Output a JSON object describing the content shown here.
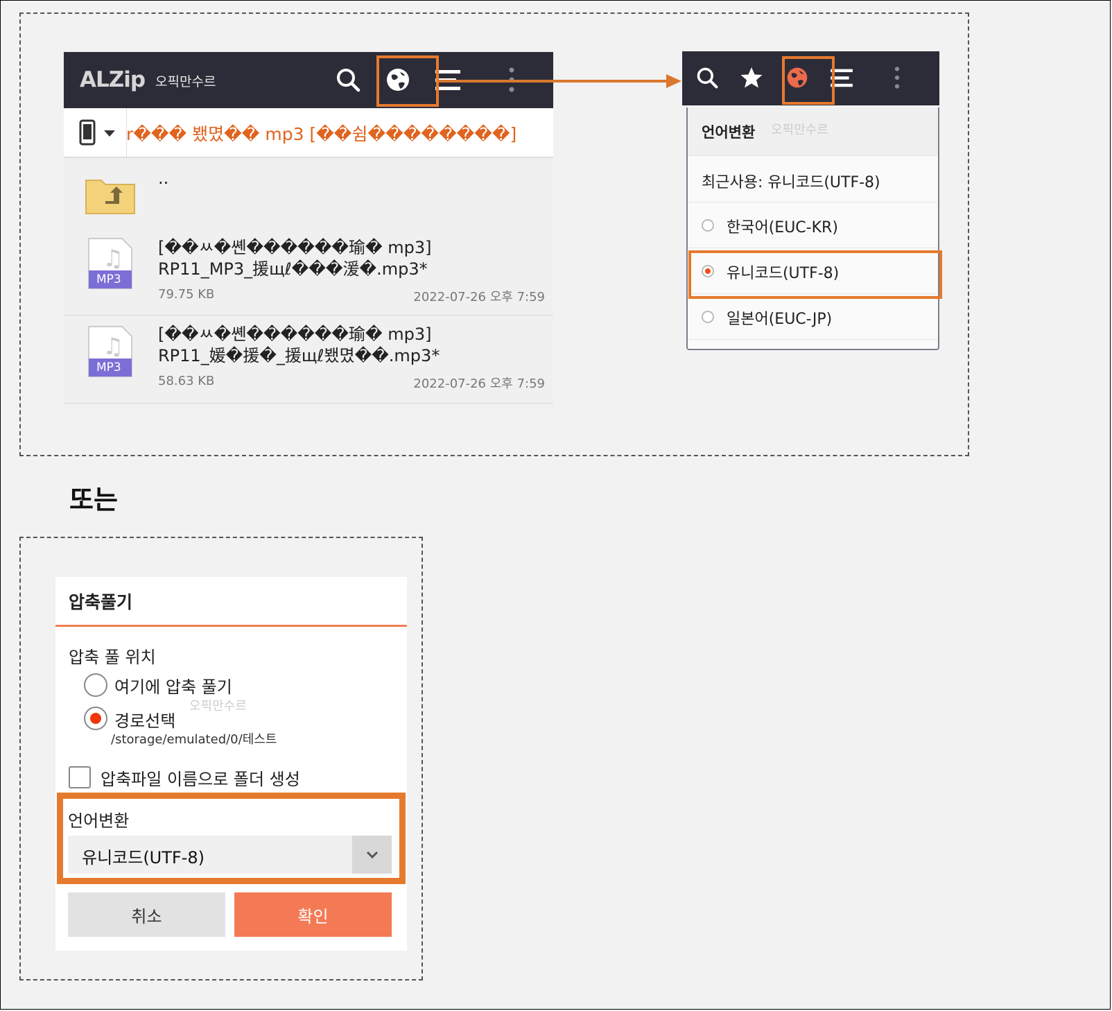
{
  "top_app": {
    "brand": "ALZip",
    "brand_sub": "오픽만수르",
    "icons": [
      "search-icon",
      "globe-icon",
      "sort-icon",
      "more-vertical-icon"
    ],
    "path": "r��� 뵀몄�� mp3 [��쉼��������]",
    "parent_label": "..",
    "files": [
      {
        "line1": "[��ㅆ�쏀������瑜� mp3]",
        "line2": "RP11_MP3_援щℓ���湲�.mp3*",
        "size": "79.75 KB",
        "date": "2022-07-26 오후 7:59",
        "badge": "MP3"
      },
      {
        "line1": "[��ㅆ�쏀������瑜� mp3]",
        "line2": "RP11_媛�援�_援щℓ뵀몄��.mp3*",
        "size": "58.63 KB",
        "date": "2022-07-26 오후 7:59",
        "badge": "MP3"
      }
    ]
  },
  "right_menu": {
    "header": "언어변환",
    "header_watermark": "오픽만수르",
    "recent": "최근사용: 유니코드(UTF-8)",
    "options": [
      {
        "label": "한국어(EUC-KR)",
        "selected": false
      },
      {
        "label": "유니코드(UTF-8)",
        "selected": true
      },
      {
        "label": "일본어(EUC-JP)",
        "selected": false
      }
    ],
    "icons": [
      "search-icon",
      "star-icon",
      "globe-icon",
      "sort-icon",
      "more-vertical-icon"
    ]
  },
  "or_label": "또는",
  "dialog": {
    "title": "압축풀기",
    "location_label": "압축 풀 위치",
    "option_here": "여기에 압축 풀기",
    "option_path": "경로선택",
    "path_watermark": "오픽만수르",
    "path_value": "/storage/emulated/0/테스트",
    "checkbox_label": "압축파일 이름으로 폴더 생성",
    "lang_label": "언어변환",
    "lang_value": "유니코드(UTF-8)",
    "cancel": "취소",
    "confirm": "확인"
  },
  "colors": {
    "highlight": "#e57a2e",
    "appbar": "#2c2c38",
    "path_text": "#e0631e",
    "confirm_bg": "#f47a55",
    "radio_on": "#f04e1e"
  }
}
